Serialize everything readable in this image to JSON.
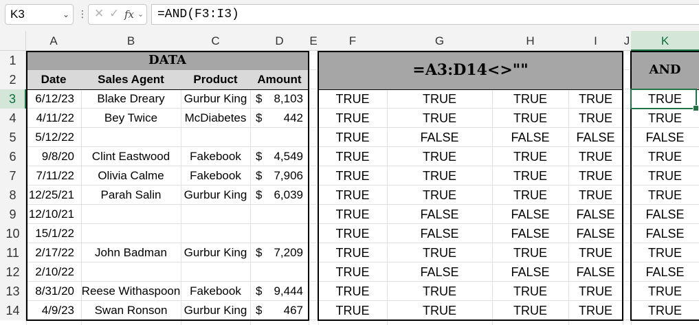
{
  "name_box": "K3",
  "formula": "=AND(F3:I3)",
  "columns": [
    "A",
    "B",
    "C",
    "D",
    "E",
    "F",
    "G",
    "H",
    "I",
    "J",
    "K"
  ],
  "rows": [
    "1",
    "2",
    "3",
    "4",
    "5",
    "6",
    "7",
    "8",
    "9",
    "10",
    "11",
    "12",
    "13",
    "14"
  ],
  "data_title": "DATA",
  "data_headers": [
    "Date",
    "Sales Agent",
    "Product",
    "Amount"
  ],
  "data_rows": [
    [
      "6/12/23",
      "Blake Dreary",
      "Gurbur King",
      "$",
      "8,103"
    ],
    [
      "4/11/22",
      "Bey Twice",
      "McDiabetes",
      "$",
      "442"
    ],
    [
      "5/12/22",
      "",
      "",
      "",
      ""
    ],
    [
      "9/8/20",
      "Clint Eastwood",
      "Fakebook",
      "$",
      "4,549"
    ],
    [
      "7/11/22",
      "Olivia Calme",
      "Fakebook",
      "$",
      "7,906"
    ],
    [
      "12/25/21",
      "Parah Salin",
      "Gurbur King",
      "$",
      "6,039"
    ],
    [
      "12/10/21",
      "",
      "",
      "",
      ""
    ],
    [
      "15/1/22",
      "",
      "",
      "",
      ""
    ],
    [
      "2/17/22",
      "John Badman",
      "Gurbur King",
      "$",
      "7,209"
    ],
    [
      "2/10/22",
      "",
      "",
      "",
      ""
    ],
    [
      "8/31/20",
      "Reese Withaspoon",
      "Fakebook",
      "$",
      "9,444"
    ],
    [
      "4/9/23",
      "Swan Ronson",
      "Gurbur King",
      "$",
      "467"
    ]
  ],
  "check_title": "=A3:D14<>\"\"",
  "check_rows": [
    [
      "TRUE",
      "TRUE",
      "TRUE",
      "TRUE"
    ],
    [
      "TRUE",
      "TRUE",
      "TRUE",
      "TRUE"
    ],
    [
      "TRUE",
      "FALSE",
      "FALSE",
      "FALSE"
    ],
    [
      "TRUE",
      "TRUE",
      "TRUE",
      "TRUE"
    ],
    [
      "TRUE",
      "TRUE",
      "TRUE",
      "TRUE"
    ],
    [
      "TRUE",
      "TRUE",
      "TRUE",
      "TRUE"
    ],
    [
      "TRUE",
      "FALSE",
      "FALSE",
      "FALSE"
    ],
    [
      "TRUE",
      "FALSE",
      "FALSE",
      "FALSE"
    ],
    [
      "TRUE",
      "TRUE",
      "TRUE",
      "TRUE"
    ],
    [
      "TRUE",
      "FALSE",
      "FALSE",
      "FALSE"
    ],
    [
      "TRUE",
      "TRUE",
      "TRUE",
      "TRUE"
    ],
    [
      "TRUE",
      "TRUE",
      "TRUE",
      "TRUE"
    ]
  ],
  "and_title": "AND",
  "and_values": [
    "TRUE",
    "TRUE",
    "FALSE",
    "TRUE",
    "TRUE",
    "TRUE",
    "FALSE",
    "FALSE",
    "TRUE",
    "FALSE",
    "TRUE",
    "TRUE"
  ],
  "icons": {
    "cancel": "close-icon",
    "enter": "checkmark-icon",
    "function": "fx-icon",
    "name_box_dropdown": "chevron-down-icon"
  },
  "colors": {
    "accent": "#217346",
    "header_fill": "#a6a6a6"
  }
}
